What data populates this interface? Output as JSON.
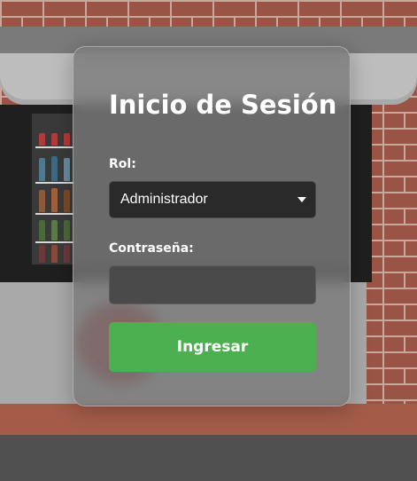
{
  "login": {
    "title": "Inicio de Sesión",
    "role_label": "Rol:",
    "role_selected": "Administrador",
    "password_label": "Contraseña:",
    "password_value": "",
    "submit_label": "Ingresar"
  },
  "icons": {
    "select_caret": "caret-down-icon"
  },
  "colors": {
    "submit_button": "#4caf50",
    "card_background": "#787878",
    "input_background": "#2a2a2a"
  }
}
